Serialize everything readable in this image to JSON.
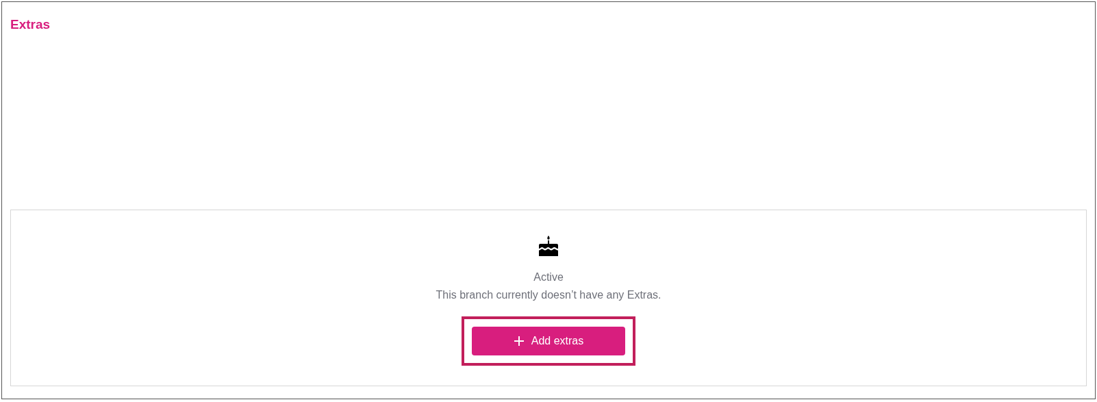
{
  "title": "Extras",
  "empty_state": {
    "status": "Active",
    "message": "This branch currently doesn’t have any Extras."
  },
  "action_button": {
    "label": "Add extras",
    "highlighted": true
  }
}
